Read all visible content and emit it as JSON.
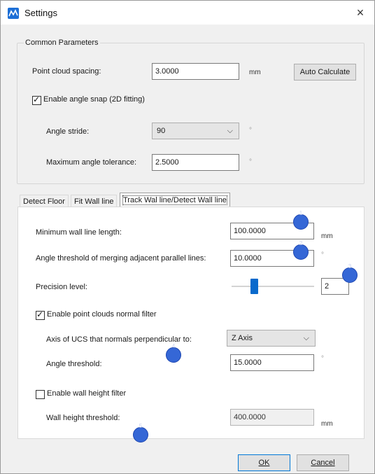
{
  "window": {
    "title": "Settings",
    "close_glyph": "×"
  },
  "common": {
    "group_title": "Common Parameters",
    "point_cloud_spacing": {
      "label": "Point cloud spacing:",
      "value": "3.0000",
      "unit": "mm"
    },
    "auto_calculate_label": "Auto Calculate",
    "angle_snap": {
      "label": "Enable angle snap (2D fitting)",
      "checked": true
    },
    "angle_stride": {
      "label": "Angle stride:",
      "value": "90",
      "unit": "°"
    },
    "max_angle_tolerance": {
      "label": "Maximum angle tolerance:",
      "value": "2.5000",
      "unit": "°"
    }
  },
  "tabs": [
    {
      "label": "Detect Floor"
    },
    {
      "label": "Fit Wall line"
    },
    {
      "label": "Track Wal line/Detect Wall line",
      "active": true
    }
  ],
  "track": {
    "min_wall_line_length": {
      "label": "Minimum wall line length:",
      "value": "100.0000",
      "unit": "mm"
    },
    "angle_threshold_merge": {
      "label": "Angle threshold of merging adjacent parallel lines:",
      "value": "10.0000",
      "unit": "°"
    },
    "precision_level": {
      "label": "Precision level:",
      "value": "2"
    },
    "normal_filter": {
      "label": "Enable point clouds normal filter",
      "checked": true
    },
    "ucs_axis": {
      "label": "Axis of UCS that normals perpendicular to:",
      "value": "Z Axis"
    },
    "angle_threshold": {
      "label": "Angle threshold:",
      "value": "15.0000",
      "unit": "°"
    },
    "wall_height_filter": {
      "label": "Enable wall height filter",
      "checked": false
    },
    "wall_height_threshold": {
      "label": "Wall height threshold:",
      "value": "400.0000",
      "unit": "mm"
    }
  },
  "markers": [
    {
      "number": "1",
      "color": "#3567d6"
    },
    {
      "number": "2",
      "color": "#3567d6"
    },
    {
      "number": "3",
      "color": "#3567d6"
    },
    {
      "number": "4",
      "color": "#3567d6"
    },
    {
      "number": "5",
      "color": "#3567d6"
    }
  ],
  "footer": {
    "ok_label": "OK",
    "cancel_label": "Cancel"
  },
  "colors": {
    "accent": "#0078d7",
    "slider_thumb": "#0a6acc",
    "marker": "#3567d6"
  },
  "icons": {
    "app": "settings-app-icon",
    "close": "close-icon",
    "chevron": "chevron-down-icon"
  }
}
